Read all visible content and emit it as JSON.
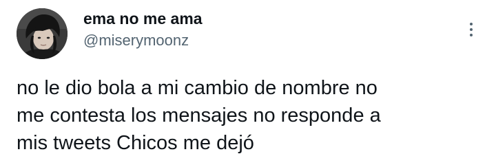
{
  "author": {
    "display_name": "ema no me ama",
    "handle": "@miserymoonz",
    "avatar_icon": "profile-photo"
  },
  "menu_icon": "more-vertical-icon",
  "tweet": {
    "lines": [
      "no le dio bola a mi cambio de nombre no",
      "me contesta los mensajes no responde a",
      "mis tweets Chicos me dejó"
    ]
  },
  "colors": {
    "text": "#0f1419",
    "secondary": "#536471",
    "background": "#ffffff"
  }
}
